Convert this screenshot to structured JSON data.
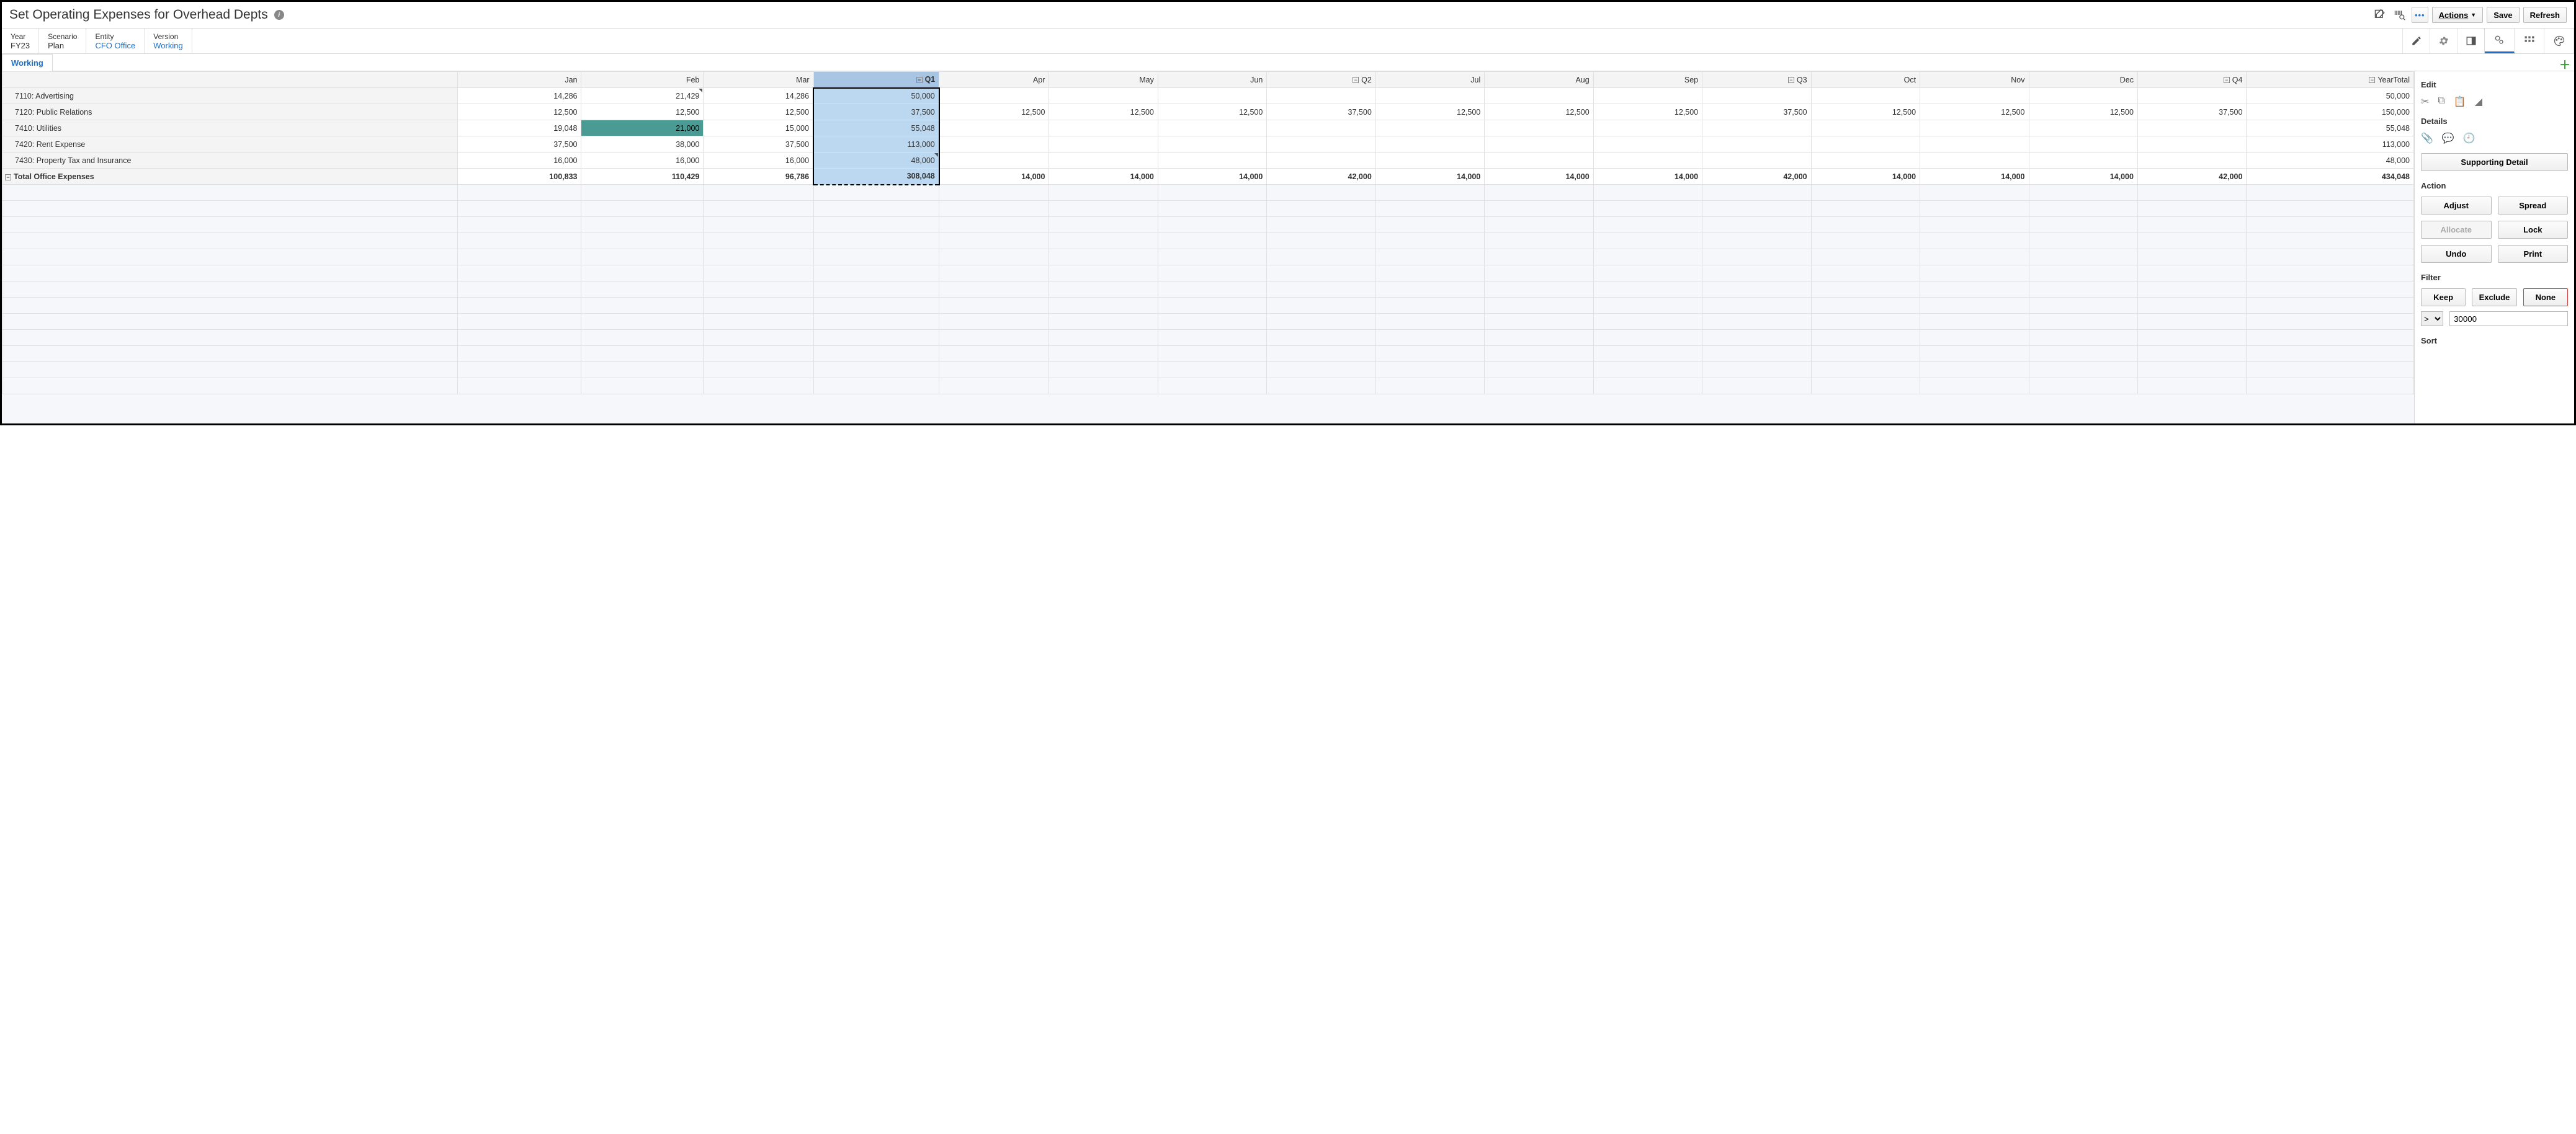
{
  "header": {
    "title": "Set Operating Expenses for Overhead Depts",
    "actions_label": "Actions",
    "save_label": "Save",
    "refresh_label": "Refresh"
  },
  "pov": {
    "year": {
      "label": "Year",
      "value": "FY23"
    },
    "scenario": {
      "label": "Scenario",
      "value": "Plan"
    },
    "entity": {
      "label": "Entity",
      "value": "CFO Office"
    },
    "version": {
      "label": "Version",
      "value": "Working"
    }
  },
  "tab": {
    "working": "Working"
  },
  "grid": {
    "columns": [
      "Jan",
      "Feb",
      "Mar",
      "Q1",
      "Apr",
      "May",
      "Jun",
      "Q2",
      "Jul",
      "Aug",
      "Sep",
      "Q3",
      "Oct",
      "Nov",
      "Dec",
      "Q4",
      "YearTotal"
    ],
    "quarter_cols": [
      "Q1",
      "Q2",
      "Q3",
      "Q4",
      "YearTotal"
    ],
    "rows": [
      {
        "label": "7110: Advertising",
        "cells": [
          "14,286",
          "21,429",
          "14,286",
          "50,000",
          "",
          "",
          "",
          "",
          "",
          "",
          "",
          "",
          "",
          "",
          "",
          "",
          "50,000"
        ]
      },
      {
        "label": "7120: Public Relations",
        "cells": [
          "12,500",
          "12,500",
          "12,500",
          "37,500",
          "12,500",
          "12,500",
          "12,500",
          "37,500",
          "12,500",
          "12,500",
          "12,500",
          "37,500",
          "12,500",
          "12,500",
          "12,500",
          "37,500",
          "150,000"
        ]
      },
      {
        "label": "7410: Utilities",
        "cells": [
          "19,048",
          "21,000",
          "15,000",
          "55,048",
          "",
          "",
          "",
          "",
          "",
          "",
          "",
          "",
          "",
          "",
          "",
          "",
          "55,048"
        ]
      },
      {
        "label": "7420: Rent Expense",
        "cells": [
          "37,500",
          "38,000",
          "37,500",
          "113,000",
          "",
          "",
          "",
          "",
          "",
          "",
          "",
          "",
          "",
          "",
          "",
          "",
          "113,000"
        ]
      },
      {
        "label": "7430: Property Tax and Insurance",
        "cells": [
          "16,000",
          "16,000",
          "16,000",
          "48,000",
          "",
          "",
          "",
          "",
          "",
          "",
          "",
          "",
          "",
          "",
          "",
          "",
          "48,000"
        ]
      }
    ],
    "total": {
      "label": "Total Office Expenses",
      "cells": [
        "100,833",
        "110,429",
        "96,786",
        "308,048",
        "14,000",
        "14,000",
        "14,000",
        "42,000",
        "14,000",
        "14,000",
        "14,000",
        "42,000",
        "14,000",
        "14,000",
        "14,000",
        "42,000",
        "434,048"
      ]
    }
  },
  "side": {
    "edit_title": "Edit",
    "details_title": "Details",
    "supporting_detail": "Supporting Detail",
    "action_title": "Action",
    "adjust": "Adjust",
    "spread": "Spread",
    "allocate": "Allocate",
    "lock": "Lock",
    "undo": "Undo",
    "print": "Print",
    "filter_title": "Filter",
    "keep": "Keep",
    "exclude": "Exclude",
    "none": "None",
    "filter_op": ">",
    "filter_value": "30000",
    "sort_title": "Sort"
  }
}
